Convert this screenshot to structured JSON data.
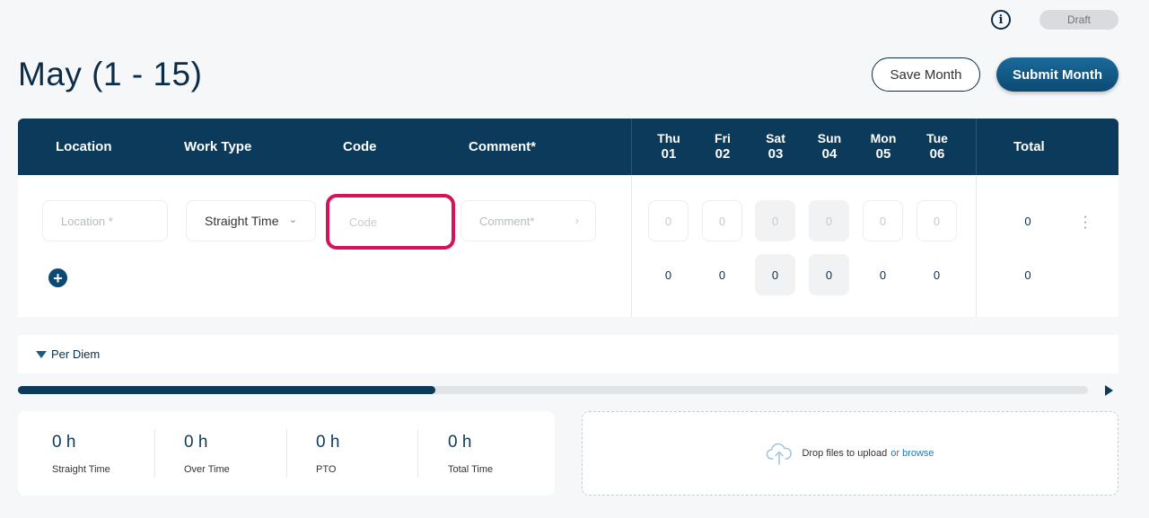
{
  "header": {
    "status_badge": "Draft",
    "title": "May (1 - 15)",
    "save_label": "Save Month",
    "submit_label": "Submit Month"
  },
  "table": {
    "columns": [
      "Location",
      "Work Type",
      "Code",
      "Comment*"
    ],
    "days": [
      {
        "dow": "Thu",
        "num": "01"
      },
      {
        "dow": "Fri",
        "num": "02"
      },
      {
        "dow": "Sat",
        "num": "03"
      },
      {
        "dow": "Sun",
        "num": "04"
      },
      {
        "dow": "Mon",
        "num": "05"
      },
      {
        "dow": "Tue",
        "num": "06"
      }
    ],
    "total_label": "Total"
  },
  "row": {
    "location_placeholder": "Location *",
    "work_type": "Straight Time",
    "code_placeholder": "Code",
    "comment_placeholder": "Comment*",
    "day_values": [
      "0",
      "0",
      "0",
      "0",
      "0",
      "0"
    ],
    "row_total": "0"
  },
  "day_totals": [
    "0",
    "0",
    "0",
    "0",
    "0",
    "0"
  ],
  "grand_total": "0",
  "per_diem_label": "Per Diem",
  "summary": [
    {
      "value": "0 h",
      "label": "Straight Time"
    },
    {
      "value": "0 h",
      "label": "Over Time"
    },
    {
      "value": "0 h",
      "label": "PTO"
    },
    {
      "value": "0 h",
      "label": "Total Time"
    }
  ],
  "upload": {
    "text": "Drop files to upload",
    "browse": "or browse"
  },
  "scroll_fraction": 0.39,
  "colors": {
    "header_bg": "#0c3a5a",
    "accent": "#0c4a73",
    "highlight": "#d4145a"
  }
}
